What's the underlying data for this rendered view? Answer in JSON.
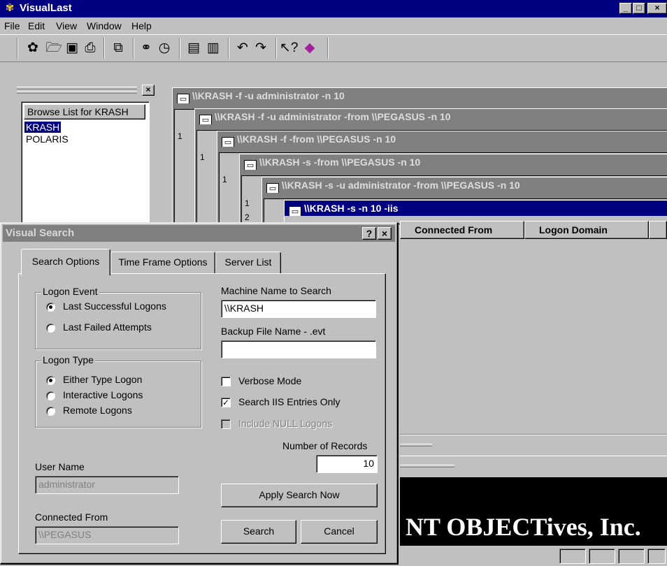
{
  "app": {
    "title": "VisualLast"
  },
  "menu": [
    {
      "label": "File"
    },
    {
      "label": "Edit"
    },
    {
      "label": "View"
    },
    {
      "label": "Window"
    },
    {
      "label": "Help"
    }
  ],
  "toolbar": {
    "icons": [
      "app-logo-icon",
      "open-folder-icon",
      "save-icon",
      "print-icon",
      "copy-icon",
      "find-icon",
      "clock-icon",
      "report-icon",
      "report-export-icon",
      "undo-icon",
      "redo-icon",
      "context-help-icon",
      "eraser-icon"
    ]
  },
  "browse": {
    "header": "Browse List for KRASH",
    "items": [
      "KRASH",
      "POLARIS"
    ],
    "selected": "KRASH"
  },
  "windows": [
    {
      "title": "\\\\KRASH -f -u administrator -n 10"
    },
    {
      "title": "\\\\KRASH -f -u administrator -from \\\\PEGASUS -n 10"
    },
    {
      "title": "\\\\KRASH -f -from \\\\PEGASUS -n 10"
    },
    {
      "title": "\\\\KRASH -s -from \\\\PEGASUS -n 10"
    },
    {
      "title": "\\\\KRASH -s -u administrator -from \\\\PEGASUS -n 10"
    },
    {
      "title": "\\\\KRASH -s -n 10 -iis"
    }
  ],
  "row_numbers": [
    "1",
    "1",
    "1",
    "1",
    "2"
  ],
  "list": {
    "columns": [
      "Connected From",
      "Logon Domain"
    ]
  },
  "banner": "NT OBJECTives, Inc.",
  "dialog": {
    "title": "Visual Search",
    "help_btn": "?",
    "close_btn": "×",
    "tabs": [
      "Search Options",
      "Time Frame Options",
      "Server List"
    ],
    "logon_event": {
      "label": "Logon Event",
      "options": [
        "Last Successful Logons",
        "Last Failed Attempts"
      ],
      "selected": 0
    },
    "logon_type": {
      "label": "Logon Type",
      "options": [
        "Either Type Logon",
        "Interactive Logons",
        "Remote Logons"
      ],
      "selected": 0
    },
    "machine_label": "Machine Name to Search",
    "machine_value": "\\\\KRASH",
    "backup_label": "Backup File Name - .evt",
    "backup_value": "",
    "verbose": {
      "label": "Verbose Mode",
      "checked": false
    },
    "iis": {
      "label": "Search IIS Entries Only",
      "checked": true
    },
    "null_logons": {
      "label": "Include NULL Logons",
      "checked": false,
      "disabled": true
    },
    "records_label": "Number of Records",
    "records_value": "10",
    "user_label": "User Name",
    "user_value": "administrator",
    "from_label": "Connected From",
    "from_value": "\\\\PEGASUS",
    "apply_btn": "Apply Search Now",
    "search_btn": "Search",
    "cancel_btn": "Cancel"
  }
}
